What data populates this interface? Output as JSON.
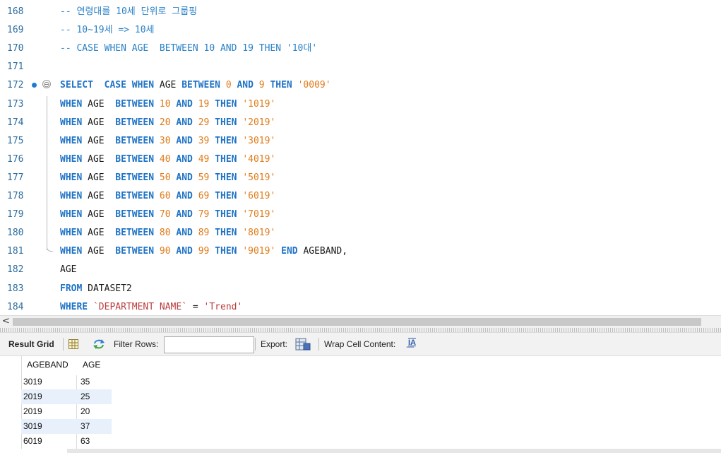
{
  "editor": {
    "lines": [
      {
        "num": "168",
        "tokens": [
          {
            "t": "-- 연령대를 10세 단위로 그룹핑",
            "c": "cm"
          }
        ]
      },
      {
        "num": "169",
        "tokens": [
          {
            "t": "-- 10~19세 => 10세",
            "c": "cm"
          }
        ]
      },
      {
        "num": "170",
        "tokens": [
          {
            "t": "-- CASE WHEN AGE  BETWEEN 10 AND 19 THEN '10대'",
            "c": "cm"
          }
        ]
      },
      {
        "num": "171",
        "tokens": []
      },
      {
        "num": "172",
        "marker": true,
        "fold": "⊖",
        "tokens": [
          {
            "t": "SELECT  CASE WHEN ",
            "c": "kw"
          },
          {
            "t": "AGE ",
            "c": "id"
          },
          {
            "t": "BETWEEN ",
            "c": "kw"
          },
          {
            "t": "0 ",
            "c": "num"
          },
          {
            "t": "AND ",
            "c": "kw"
          },
          {
            "t": "9 ",
            "c": "num"
          },
          {
            "t": "THEN ",
            "c": "kw"
          },
          {
            "t": "'0009'",
            "c": "str"
          }
        ]
      },
      {
        "num": "173",
        "tokens": [
          {
            "t": "WHEN ",
            "c": "kw"
          },
          {
            "t": "AGE  ",
            "c": "id"
          },
          {
            "t": "BETWEEN ",
            "c": "kw"
          },
          {
            "t": "10 ",
            "c": "num"
          },
          {
            "t": "AND ",
            "c": "kw"
          },
          {
            "t": "19 ",
            "c": "num"
          },
          {
            "t": "THEN ",
            "c": "kw"
          },
          {
            "t": "'1019'",
            "c": "str"
          }
        ]
      },
      {
        "num": "174",
        "tokens": [
          {
            "t": "WHEN ",
            "c": "kw"
          },
          {
            "t": "AGE  ",
            "c": "id"
          },
          {
            "t": "BETWEEN ",
            "c": "kw"
          },
          {
            "t": "20 ",
            "c": "num"
          },
          {
            "t": "AND ",
            "c": "kw"
          },
          {
            "t": "29 ",
            "c": "num"
          },
          {
            "t": "THEN ",
            "c": "kw"
          },
          {
            "t": "'2019'",
            "c": "str"
          }
        ]
      },
      {
        "num": "175",
        "tokens": [
          {
            "t": "WHEN ",
            "c": "kw"
          },
          {
            "t": "AGE  ",
            "c": "id"
          },
          {
            "t": "BETWEEN ",
            "c": "kw"
          },
          {
            "t": "30 ",
            "c": "num"
          },
          {
            "t": "AND ",
            "c": "kw"
          },
          {
            "t": "39 ",
            "c": "num"
          },
          {
            "t": "THEN ",
            "c": "kw"
          },
          {
            "t": "'3019'",
            "c": "str"
          }
        ]
      },
      {
        "num": "176",
        "tokens": [
          {
            "t": "WHEN ",
            "c": "kw"
          },
          {
            "t": "AGE  ",
            "c": "id"
          },
          {
            "t": "BETWEEN ",
            "c": "kw"
          },
          {
            "t": "40 ",
            "c": "num"
          },
          {
            "t": "AND ",
            "c": "kw"
          },
          {
            "t": "49 ",
            "c": "num"
          },
          {
            "t": "THEN ",
            "c": "kw"
          },
          {
            "t": "'4019'",
            "c": "str"
          }
        ]
      },
      {
        "num": "177",
        "tokens": [
          {
            "t": "WHEN ",
            "c": "kw"
          },
          {
            "t": "AGE  ",
            "c": "id"
          },
          {
            "t": "BETWEEN ",
            "c": "kw"
          },
          {
            "t": "50 ",
            "c": "num"
          },
          {
            "t": "AND ",
            "c": "kw"
          },
          {
            "t": "59 ",
            "c": "num"
          },
          {
            "t": "THEN ",
            "c": "kw"
          },
          {
            "t": "'5019'",
            "c": "str"
          }
        ]
      },
      {
        "num": "178",
        "tokens": [
          {
            "t": "WHEN ",
            "c": "kw"
          },
          {
            "t": "AGE  ",
            "c": "id"
          },
          {
            "t": "BETWEEN ",
            "c": "kw"
          },
          {
            "t": "60 ",
            "c": "num"
          },
          {
            "t": "AND ",
            "c": "kw"
          },
          {
            "t": "69 ",
            "c": "num"
          },
          {
            "t": "THEN ",
            "c": "kw"
          },
          {
            "t": "'6019'",
            "c": "str"
          }
        ]
      },
      {
        "num": "179",
        "tokens": [
          {
            "t": "WHEN ",
            "c": "kw"
          },
          {
            "t": "AGE  ",
            "c": "id"
          },
          {
            "t": "BETWEEN ",
            "c": "kw"
          },
          {
            "t": "70 ",
            "c": "num"
          },
          {
            "t": "AND ",
            "c": "kw"
          },
          {
            "t": "79 ",
            "c": "num"
          },
          {
            "t": "THEN ",
            "c": "kw"
          },
          {
            "t": "'7019'",
            "c": "str"
          }
        ]
      },
      {
        "num": "180",
        "tokens": [
          {
            "t": "WHEN ",
            "c": "kw"
          },
          {
            "t": "AGE  ",
            "c": "id"
          },
          {
            "t": "BETWEEN ",
            "c": "kw"
          },
          {
            "t": "80 ",
            "c": "num"
          },
          {
            "t": "AND ",
            "c": "kw"
          },
          {
            "t": "89 ",
            "c": "num"
          },
          {
            "t": "THEN ",
            "c": "kw"
          },
          {
            "t": "'8019'",
            "c": "str"
          }
        ]
      },
      {
        "num": "181",
        "tokens": [
          {
            "t": "WHEN ",
            "c": "kw"
          },
          {
            "t": "AGE  ",
            "c": "id"
          },
          {
            "t": "BETWEEN ",
            "c": "kw"
          },
          {
            "t": "90 ",
            "c": "num"
          },
          {
            "t": "AND ",
            "c": "kw"
          },
          {
            "t": "99 ",
            "c": "num"
          },
          {
            "t": "THEN ",
            "c": "kw"
          },
          {
            "t": "'9019' ",
            "c": "str"
          },
          {
            "t": "END ",
            "c": "kw"
          },
          {
            "t": "AGEBAND,",
            "c": "id"
          }
        ]
      },
      {
        "num": "182",
        "tokens": [
          {
            "t": "AGE",
            "c": "id"
          }
        ]
      },
      {
        "num": "183",
        "tokens": [
          {
            "t": "FROM ",
            "c": "kw"
          },
          {
            "t": "DATASET2",
            "c": "id"
          }
        ]
      },
      {
        "num": "184",
        "tokens": [
          {
            "t": "WHERE ",
            "c": "kw"
          },
          {
            "t": "`DEPARTMENT NAME`",
            "c": "bq"
          },
          {
            "t": " = ",
            "c": "op"
          },
          {
            "t": "'Trend'",
            "c": "bq"
          }
        ]
      }
    ]
  },
  "hscroll": {
    "left_arrow": "<"
  },
  "toolbar": {
    "result_grid_label": "Result Grid",
    "filter_rows_label": "Filter Rows:",
    "filter_rows_value": "",
    "export_label": "Export:",
    "wrap_cell_label": "Wrap Cell Content:",
    "wrap_icon_glyph": "I͟A"
  },
  "grid": {
    "columns": [
      "AGEBAND",
      "AGE"
    ],
    "rows": [
      [
        "3019",
        "35"
      ],
      [
        "2019",
        "25"
      ],
      [
        "2019",
        "20"
      ],
      [
        "3019",
        "37"
      ],
      [
        "6019",
        "63"
      ]
    ]
  },
  "colors": {
    "keyword": "#1f73c6",
    "number_string": "#e07b18",
    "comment": "#2b82c7",
    "backtick_ident": "#b93c3c",
    "row_alt": "#e8f0fb"
  }
}
